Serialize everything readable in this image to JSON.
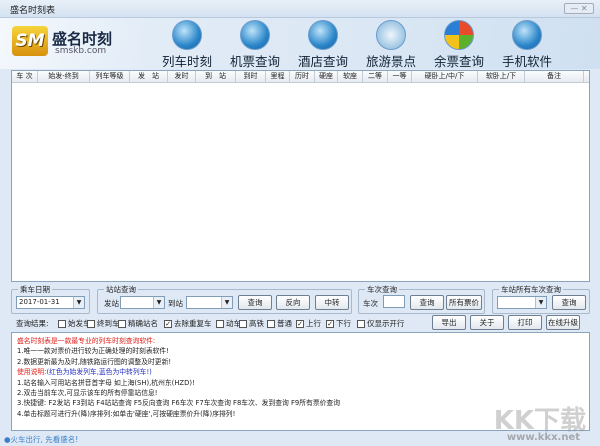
{
  "window": {
    "title": "盛名时刻表",
    "controls": "— ✕"
  },
  "logo": {
    "mark": "SM",
    "name": "盛名时刻",
    "url": "smskb.com"
  },
  "nav": [
    "列车时刻",
    "机票查询",
    "酒店查询",
    "旅游景点",
    "余票查询",
    "手机软件"
  ],
  "columns": [
    "车 次",
    "始发-终到",
    "列车等级",
    "发　站",
    "发时",
    "到　站",
    "到时",
    "里程",
    "历时",
    "硬座",
    "软座",
    "二等",
    "一等",
    "硬卧上/中/下",
    "软卧上/下",
    "备注"
  ],
  "date_group": {
    "label": "乘车日期",
    "value": "2017-01-31"
  },
  "station_group": {
    "label": "站站查询",
    "from_label": "发站",
    "from_value": "",
    "to_label": "到站",
    "to_value": "",
    "query": "查询",
    "reverse": "反向",
    "transfer": "中转"
  },
  "train_group": {
    "label": "车次查询",
    "train_label": "车次",
    "train_value": "",
    "query": "查询",
    "all_prices": "所有票价"
  },
  "station_all_group": {
    "label": "车站所有车次查询",
    "value": "",
    "query": "查询"
  },
  "filters": {
    "label": "查询结果:",
    "items": [
      {
        "label": "始发车",
        "checked": false
      },
      {
        "label": "终到车",
        "checked": false
      },
      {
        "label": "精确站名",
        "checked": false
      },
      {
        "label": "去除重复车",
        "checked": true
      },
      {
        "label": "动车",
        "checked": false
      },
      {
        "label": "高铁",
        "checked": false
      },
      {
        "label": "普通",
        "checked": false
      },
      {
        "label": "上行",
        "checked": true
      },
      {
        "label": "下行",
        "checked": true
      },
      {
        "label": "仅显示开行",
        "checked": false
      }
    ]
  },
  "actions": {
    "export": "导出",
    "about": "关于",
    "print": "打印",
    "upgrade": "在线升级"
  },
  "info": {
    "intro": "盛名时刻表是一款最专业的列车时刻查询软件:",
    "l1": "1.唯一一款对票价进行较为正确处理的时刻表软件!",
    "l2": "2.数据更新最为及时,随铁路运行图的调整及时更新!",
    "usage": "使用说明:",
    "usage_note": "(红色为始发列车,蓝色为中转列车!)",
    "u1": "1.站名输入可用站名拼音首字母 如上海(SH),杭州东(HZD)!",
    "u2": "2.双击当前车次,可显示该车的所有停靠站信息!",
    "u3": "3.快捷键: F2发站 F3到站 F4站站查询 F5反向查询 F6车次 F7车次查询 F8车次、发到查询 F9所有票价查询",
    "u4": "4.单击标题可进行升(降)序排列:如单击'硬座',可按硬座票价升(降)序排列!"
  },
  "status": "●火车出行, 先看盛名!",
  "watermark": {
    "logo": "KK下载",
    "url": "www.kkx.net"
  }
}
